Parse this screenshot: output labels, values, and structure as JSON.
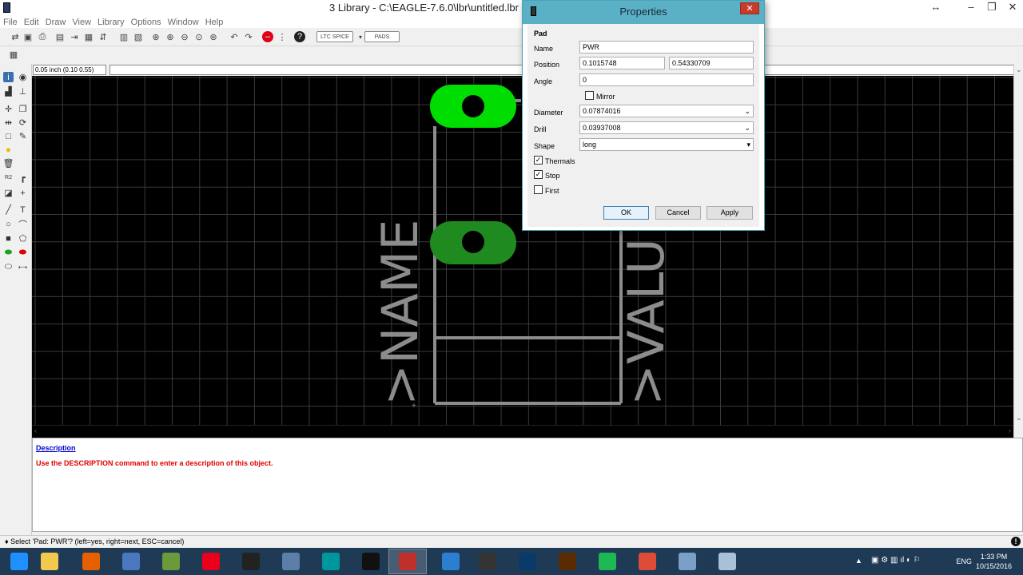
{
  "window": {
    "title": "3 Library - C:\\EAGLE-7.6.0\\lbr\\untitled.lbr (PO",
    "controls": {
      "restore_left": "↔",
      "minimize": "–",
      "maximize": "❐",
      "close": "✕"
    }
  },
  "menu": [
    "File",
    "Edit",
    "Draw",
    "View",
    "Library",
    "Options",
    "Window",
    "Help"
  ],
  "coord_display": "0.05 inch (0.10 0.55)",
  "canvas": {
    "name_label": ">NAME",
    "value_label": ">VALU",
    "pad_color_selected": "#00dd00",
    "pad_color": "#1f8a1f",
    "outline_color": "#8c8c8c",
    "grid_color": "#3a3a3a"
  },
  "description": {
    "title": "Description",
    "text": "Use the DESCRIPTION command to enter a description of this object."
  },
  "status": {
    "text": "♦ Select 'Pad: PWR'? (left=yes, right=next, ESC=cancel)"
  },
  "dialog": {
    "title": "Properties",
    "section": "Pad",
    "name_label": "Name",
    "name_value": "PWR",
    "position_label": "Position",
    "position_x": "0.1015748",
    "position_y": "0.54330709",
    "angle_label": "Angle",
    "angle_value": "0",
    "mirror_label": "Mirror",
    "mirror_checked": false,
    "diameter_label": "Diameter",
    "diameter_value": "0.07874016",
    "drill_label": "Drill",
    "drill_value": "0.03937008",
    "shape_label": "Shape",
    "shape_value": "long",
    "thermals_label": "Thermals",
    "thermals_checked": true,
    "stop_label": "Stop",
    "stop_checked": true,
    "first_label": "First",
    "first_checked": false,
    "ok_label": "OK",
    "cancel_label": "Cancel",
    "apply_label": "Apply"
  },
  "taskbar": {
    "clock_time": "1:33 PM",
    "clock_date": "10/15/2016",
    "language": "ENG",
    "apps": [
      {
        "name": "start-button",
        "color": "#1e90ff"
      },
      {
        "name": "file-explorer",
        "color": "#f2c94c"
      },
      {
        "name": "firefox",
        "color": "#e66000"
      },
      {
        "name": "app-blue",
        "color": "#4a78c0"
      },
      {
        "name": "app-green",
        "color": "#6a9a3a"
      },
      {
        "name": "opera",
        "color": "#e8001c"
      },
      {
        "name": "terminal",
        "color": "#222222"
      },
      {
        "name": "calculator",
        "color": "#5c7fa8"
      },
      {
        "name": "arduino",
        "color": "#00979c"
      },
      {
        "name": "p-app",
        "color": "#111111"
      },
      {
        "name": "eagle",
        "color": "#c0302a"
      },
      {
        "name": "c-app",
        "color": "#2a7fd0"
      },
      {
        "name": "inkscape",
        "color": "#333333"
      },
      {
        "name": "photoshop",
        "color": "#0a3a6a"
      },
      {
        "name": "illustrator",
        "color": "#5a2a00"
      },
      {
        "name": "spotify",
        "color": "#1db954"
      },
      {
        "name": "chrome",
        "color": "#dd4b39"
      },
      {
        "name": "app-window",
        "color": "#7aa0c8"
      },
      {
        "name": "app-window2",
        "color": "#a8c0d8"
      }
    ]
  }
}
